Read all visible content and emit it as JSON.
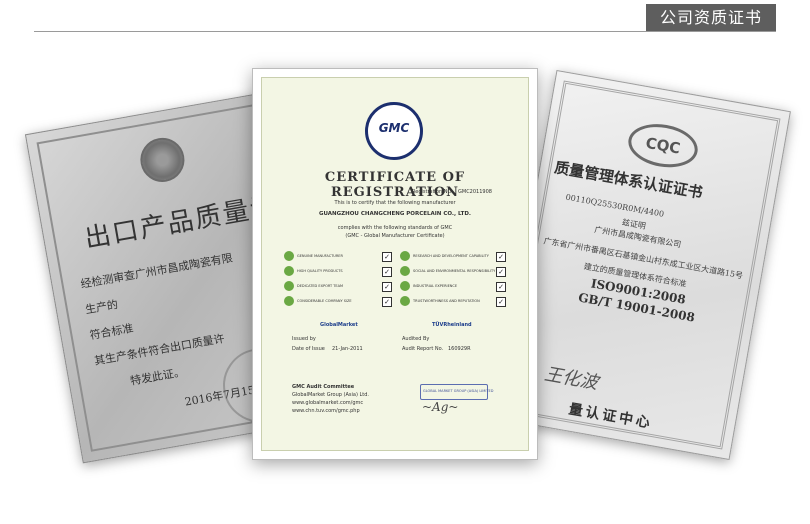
{
  "header": {
    "tag": "公司资质证书"
  },
  "left_certificate": {
    "title": "出口产品质量许可",
    "lines": [
      "经检测审查广州市昌成陶瓷有限",
      "生产的",
      "符合标准",
      "其生产条件符合出口质量许",
      "特发此证。",
      "2016年7月15"
    ]
  },
  "center_certificate": {
    "logo": "GMC",
    "title": "CERTIFICATE OF REGISTRATION",
    "registration_label": "Registration NO.",
    "registration_no": "GMC2011908",
    "certify_text": "This is to certify that the following manufacturer",
    "company": "GUANGZHOU CHANGCHENG PORCELAIN CO., LTD.",
    "complies_text": "complies with the following standards of GMC",
    "complies_sub": "(GMC - Global Manufacturer Certificate)",
    "standards": [
      {
        "label": "GENUINE MANUFACTURER"
      },
      {
        "label": "RESEARCH AND DEVELOPMENT CAPABILITY"
      },
      {
        "label": "HIGH QUALITY PRODUCTS"
      },
      {
        "label": "SOCIAL AND ENVIRONMENTAL RESPONSIBILITY"
      },
      {
        "label": "DEDICATED EXPORT TEAM"
      },
      {
        "label": "INDUSTRIAL EXPERIENCE"
      },
      {
        "label": "CONSIDERABLE COMPANY SIZE"
      },
      {
        "label": "TRUSTWORTHINESS AND REPUTATION"
      }
    ],
    "issued_by_label": "Issued by",
    "issuer_brand": "GlobalMarket",
    "date_label": "Date of Issue",
    "date": "21-Jan-2011",
    "audited_by_label": "Audited By",
    "auditor_brand": "TÜVRheinland",
    "audit_report_label": "Audit Report No.",
    "audit_report_no": "160929R",
    "committee": "GMC Audit Committee",
    "committee_org": "GlobalMarket Group (Asia) Ltd.",
    "url1": "www.globalmarket.com/gmc",
    "url2": "www.chn.tuv.com/gmc.php",
    "stamp_text": "GLOBAL MARKET GROUP (ASIA) LIMITED"
  },
  "right_certificate": {
    "logo": "CQC",
    "title": "质量管理体系认证证书",
    "cert_no": "00110Q25530R0M/4400",
    "holder_label": "兹证明",
    "holder": "广州市昌成陶瓷有限公司",
    "address_line": "广东省广州市番禺区石基镇金山村东成工业区大道路15号",
    "standard_line1": "ISO9001:2008",
    "standard_line2": "GB/T 19001-2008",
    "scope_line": "建立的质量管理体系符合标准",
    "sign_name": "王化波",
    "bottom": "量认证中心"
  }
}
